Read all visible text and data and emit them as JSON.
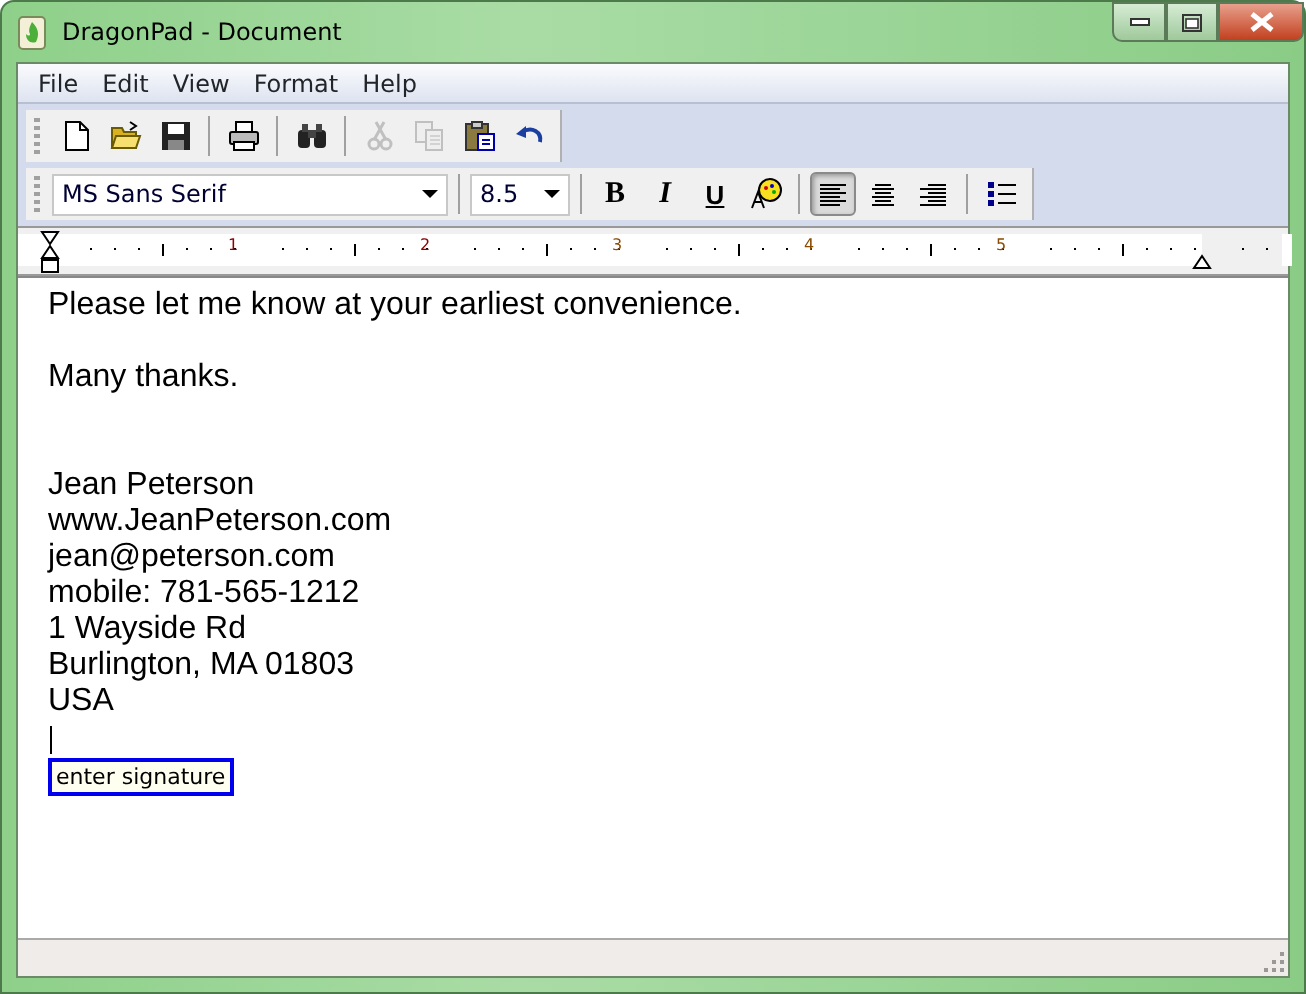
{
  "window": {
    "title": "DragonPad - Document"
  },
  "menu": [
    {
      "label": "File"
    },
    {
      "label": "Edit"
    },
    {
      "label": "View"
    },
    {
      "label": "Format"
    },
    {
      "label": "Help"
    }
  ],
  "standard_toolbar": [
    {
      "disabled": false
    },
    {
      "disabled": false
    },
    {
      "disabled": false
    },
    {
      "disabled": false
    },
    {
      "disabled": false
    },
    {
      "disabled": true
    },
    {
      "disabled": true
    },
    {
      "disabled": false
    },
    {
      "disabled": false
    }
  ],
  "format_toolbar": {
    "font": "MS Sans Serif",
    "size": "8.5",
    "style_buttons": [
      {
        "label": "B",
        "kind": "bold"
      },
      {
        "label": "I",
        "kind": "italic"
      },
      {
        "label": "U",
        "kind": "underline"
      }
    ],
    "align_buttons": [
      {
        "selected": true
      },
      {
        "selected": false
      },
      {
        "selected": false
      }
    ]
  },
  "ruler": {
    "labels": [
      "1",
      "2",
      "3",
      "4",
      "5"
    ]
  },
  "document": {
    "paragraphs": [
      {
        "kind": "body",
        "lines": [
          "Please let me know at your earliest convenience."
        ]
      },
      {
        "kind": "closing",
        "lines": [
          "Many thanks."
        ]
      },
      {
        "kind": "signature",
        "lines": [
          "Jean Peterson",
          "www.JeanPeterson.com",
          "jean@peterson.com",
          "mobile: 781-565-1212",
          "1 Wayside Rd",
          "Burlington, MA 01803",
          "USA"
        ]
      }
    ],
    "signature_button": "enter signature"
  }
}
